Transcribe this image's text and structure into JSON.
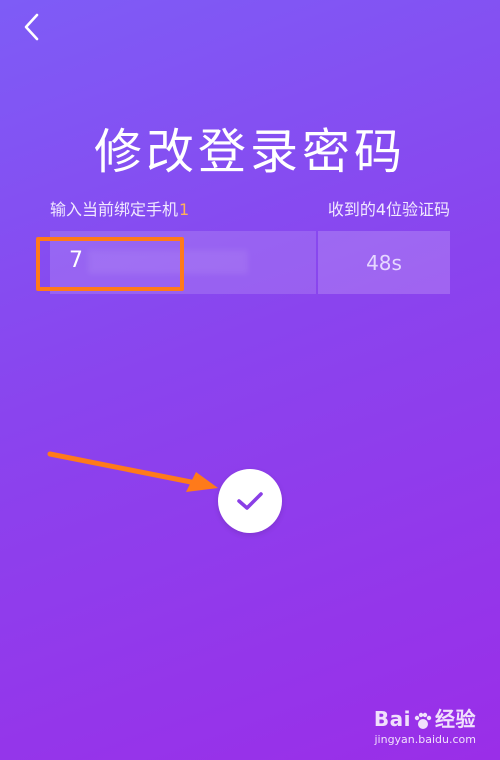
{
  "header": {
    "back_icon": "chevron-left-icon"
  },
  "page": {
    "title": "修改登录密码"
  },
  "form": {
    "phone_hint": "输入当前绑定手机",
    "phone_hint_suffix": "1",
    "code_hint": "收到的4位验证码",
    "phone_value": "7",
    "countdown": "48s"
  },
  "actions": {
    "confirm_icon": "checkmark-icon"
  },
  "watermark": {
    "brand": "Bai",
    "brand_suffix": "经验",
    "url": "jingyan.baidu.com"
  },
  "colors": {
    "background_start": "#7e5cf6",
    "background_end": "#9a2ee8",
    "highlight_box": "#ff7a1a",
    "checkmark": "#8a3fe6"
  }
}
